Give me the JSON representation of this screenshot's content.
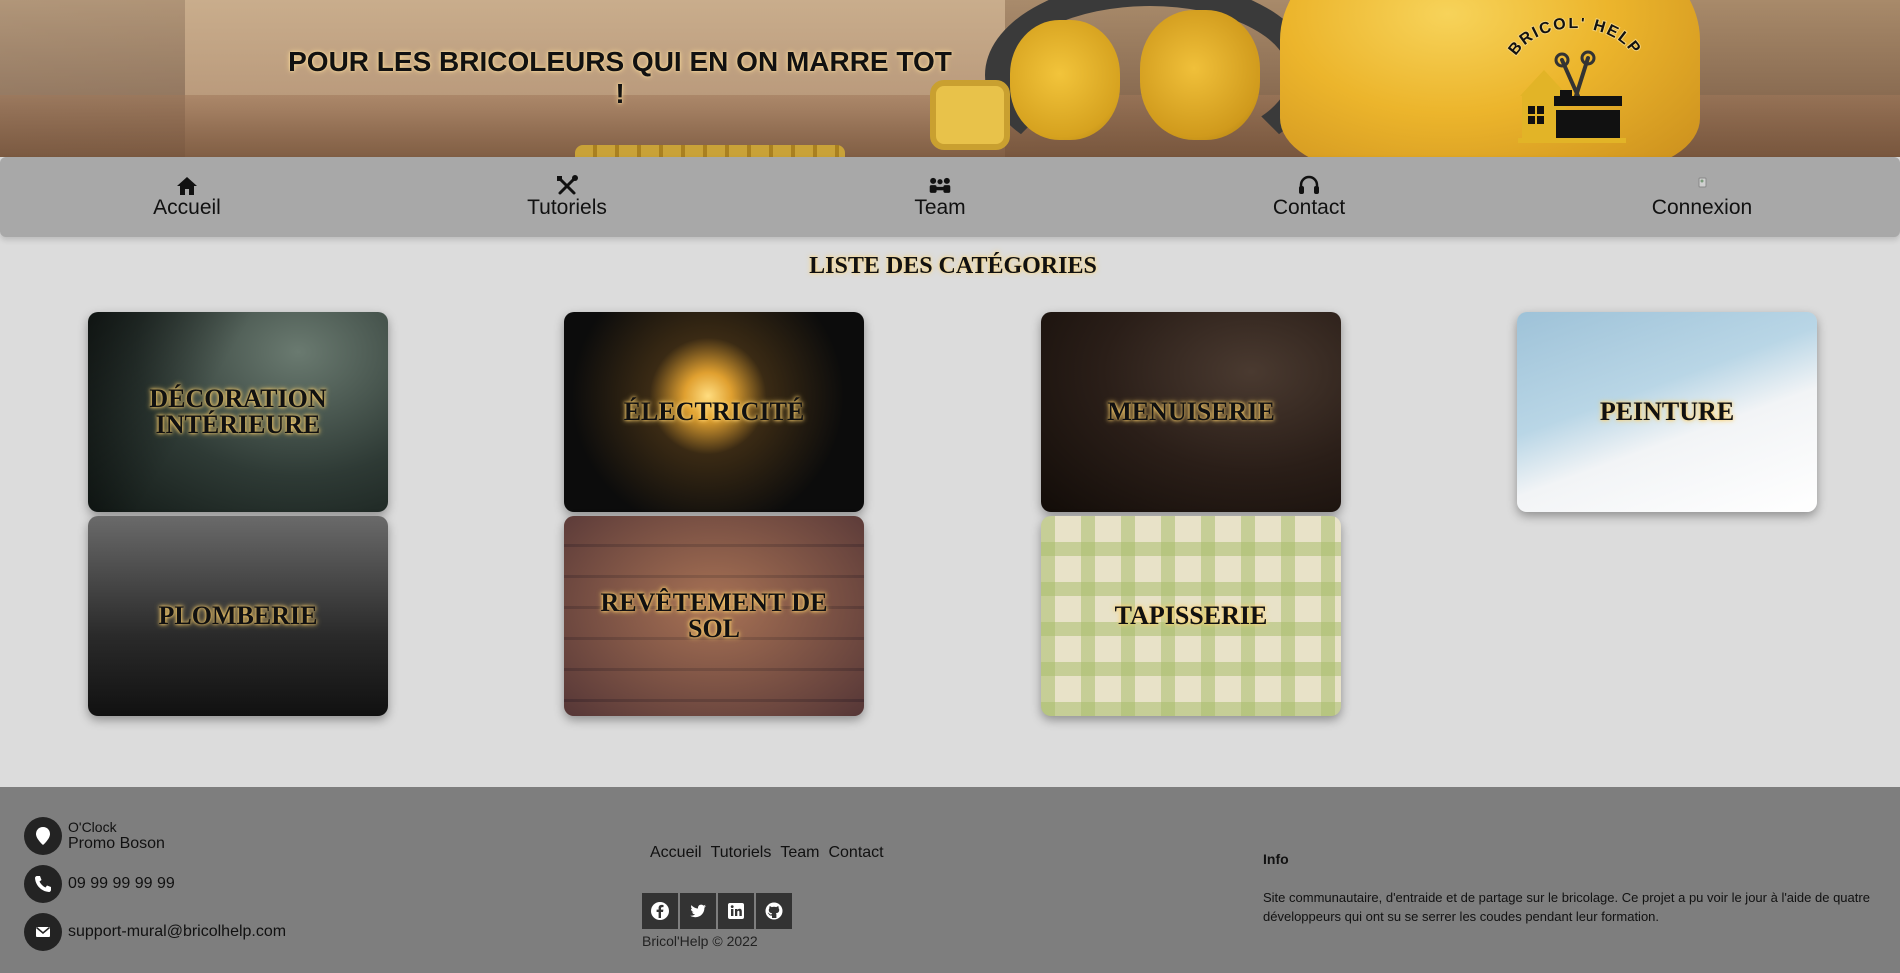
{
  "header": {
    "tagline": "POUR LES BRICOLEURS QUI EN ON MARRE TOT !",
    "logo_text": "BRICOL' HELP"
  },
  "nav": {
    "items": [
      {
        "label": "Accueil",
        "icon": "home-icon"
      },
      {
        "label": "Tutoriels",
        "icon": "tools-icon"
      },
      {
        "label": "Team",
        "icon": "team-icon"
      },
      {
        "label": "Contact",
        "icon": "headset-icon"
      },
      {
        "label": "Connexion",
        "icon": "broken-image-icon"
      }
    ]
  },
  "main": {
    "title": "LISTE DES CATÉGORIES",
    "categories": [
      {
        "label": "DÉCORATION INTÉRIEURE"
      },
      {
        "label": "ÉLECTRICITÉ"
      },
      {
        "label": "MENUISERIE"
      },
      {
        "label": "PEINTURE"
      },
      {
        "label": "PLOMBERIE"
      },
      {
        "label": "REVÊTEMENT DE SOL"
      },
      {
        "label": "TAPISSERIE"
      }
    ]
  },
  "footer": {
    "company": "O'Clock",
    "promo": "Promo Boson",
    "phone": "09 99 99 99 99",
    "email": "support-mural@bricolhelp.com",
    "links": [
      "Accueil",
      "Tutoriels",
      "Team",
      "Contact"
    ],
    "social": [
      "facebook-icon",
      "twitter-icon",
      "linkedin-icon",
      "github-icon"
    ],
    "copyright": "Bricol'Help © 2022",
    "info_title": "Info",
    "info_text": "Site communautaire, d'entraide et de partage sur le bricolage. Ce projet a pu voir le jour à l'aide de quatre développeurs qui ont su se serrer les coudes pendant leur formation."
  },
  "colors": {
    "nav_bg": "#a8a8a8",
    "page_bg": "#dcdcdc",
    "footer_bg": "#7e7e7e",
    "accent_glow": "#ffd26e",
    "logo_yellow": "#e2b427"
  }
}
